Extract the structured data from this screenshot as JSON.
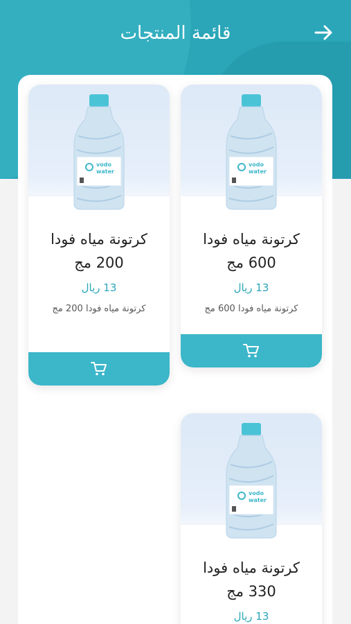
{
  "header": {
    "title": "قائمة المنتجات",
    "back_icon": "arrow-right-icon",
    "color": "#2aa6b8"
  },
  "products": [
    {
      "name": "كرتونة مياه فودا 600 مج",
      "price": "13 ريال",
      "description": "كرتونة مياه فودا 600 مج",
      "image_icon": "water-bottle-icon",
      "brand": "vodo water"
    },
    {
      "name": "كرتونة مياه فودا 200 مج",
      "price": "13 ريال",
      "description": "كرتونة مياه فودا 200 مج",
      "image_icon": "water-bottle-icon",
      "brand": "vodo water"
    },
    {
      "name": "كرتونة مياه فودا 330 مج",
      "price": "13 ريال",
      "description": "",
      "image_icon": "water-bottle-icon",
      "brand": "vodo water"
    }
  ],
  "cart_icon": "cart-icon",
  "accent_color": "#3cb6c9"
}
